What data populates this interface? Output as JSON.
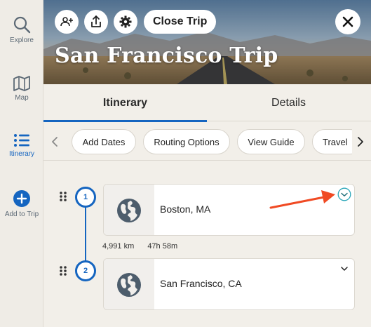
{
  "nav": {
    "items": [
      {
        "label": "Explore",
        "icon": "search-icon"
      },
      {
        "label": "Map",
        "icon": "map-icon"
      },
      {
        "label": "Itinerary",
        "icon": "list-icon"
      },
      {
        "label": "Add to Trip",
        "icon": "plus-circle-icon"
      }
    ],
    "active": "Itinerary"
  },
  "header": {
    "title": "San Francisco Trip",
    "close_trip_label": "Close Trip",
    "buttons": [
      "add-people-icon",
      "share-icon",
      "gear-icon",
      "close-icon"
    ]
  },
  "tabs": [
    {
      "label": "Itinerary",
      "active": true
    },
    {
      "label": "Details",
      "active": false
    }
  ],
  "chips": [
    "Add Dates",
    "Routing Options",
    "View Guide",
    "Travel"
  ],
  "stops": [
    {
      "number": "1",
      "name": "Boston, MA"
    },
    {
      "number": "2",
      "name": "San Francisco, CA"
    }
  ],
  "leg": {
    "distance": "4,991 km",
    "duration": "47h 58m"
  },
  "colors": {
    "accent": "#1565c0",
    "annotation_arrow": "#f04a23",
    "expand_highlight": "#2aa6b8"
  }
}
